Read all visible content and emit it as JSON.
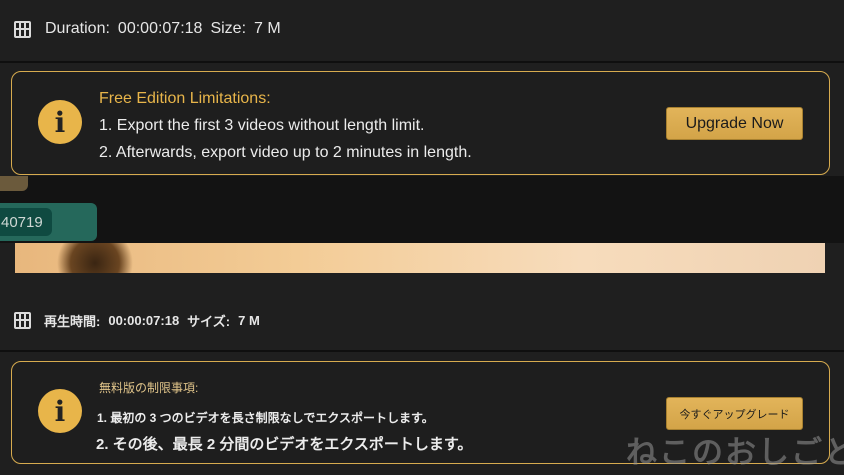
{
  "top": {
    "info_bar": {
      "duration_label": "Duration:",
      "duration_value": "00:00:07:18",
      "size_label": "Size:",
      "size_value": "7 M"
    },
    "limits": {
      "title": "Free Edition Limitations:",
      "line1": "1. Export the first 3 videos without length limit.",
      "line2": "2. Afterwards, export video up to 2 minutes in length.",
      "button": "Upgrade Now"
    }
  },
  "middle": {
    "tag_text": "40719"
  },
  "bottom": {
    "info_bar": {
      "duration_label": "再生時間:",
      "duration_value": "00:00:07:18",
      "size_label": "サイズ:",
      "size_value": "7 M"
    },
    "limits": {
      "title": "無料版の制限事項:",
      "line1": "1. 最初の 3 つのビデオを長さ制限なしでエクスポートします。",
      "line2": "2. その後、最長 2 分間のビデオをエクスポートします。",
      "button": "今すぐアップグレード"
    }
  },
  "watermark": "ねこのおしごと",
  "colors": {
    "accent": "#d7ab4f",
    "title_gold": "#e8b54a",
    "background": "#1f1f1f"
  },
  "icons": {
    "film": "film-icon",
    "info": "info-icon"
  }
}
